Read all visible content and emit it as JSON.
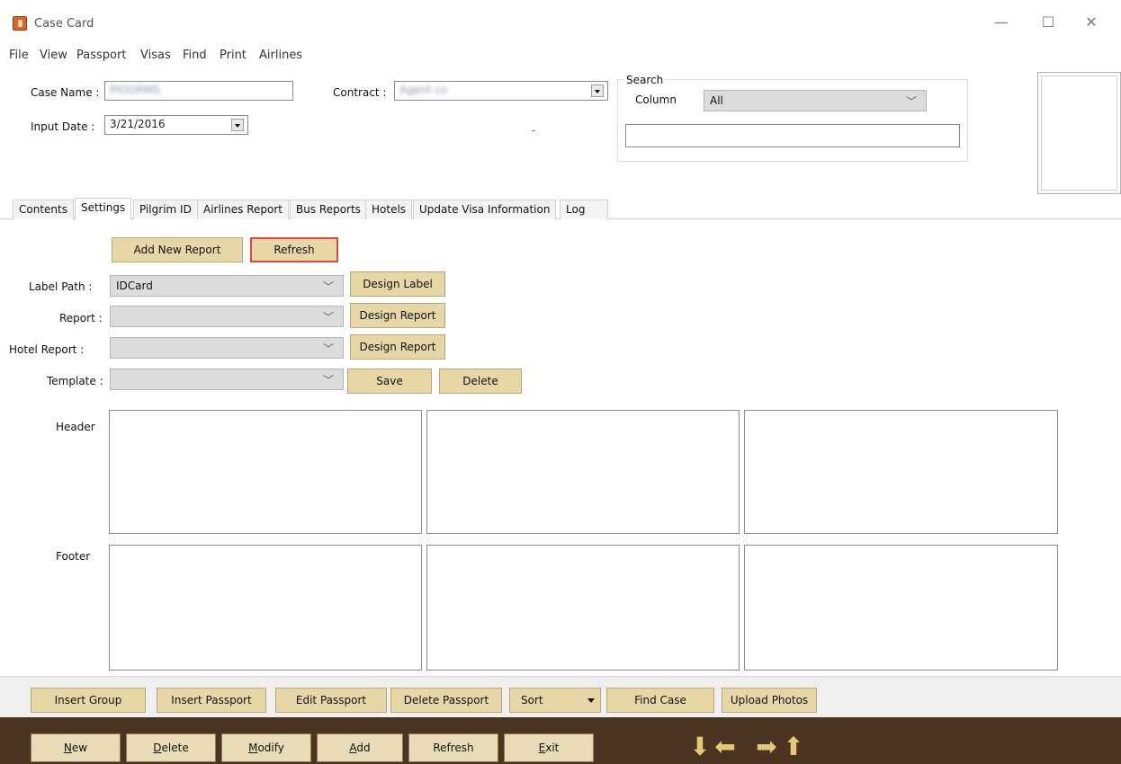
{
  "window": {
    "title": "Case Card"
  },
  "menu": [
    "File",
    "View",
    "Passport",
    "Visas",
    "Find",
    "Print",
    "Airlines"
  ],
  "header": {
    "case_name_label": "Case Name :",
    "case_name_value": "PIOGRMS",
    "contract_label": "Contract :",
    "contract_value": "Agent co",
    "input_date_label": "Input Date :",
    "input_date_value": "3/21/2016",
    "dash": "-"
  },
  "search": {
    "group_label": "Search",
    "column_label": "Column",
    "column_value": "All",
    "query_value": ""
  },
  "tabs": [
    "Contents",
    "Settings",
    "Pilgrim ID",
    "Airlines Report",
    "Bus Reports",
    "Hotels",
    "Update Visa Information",
    "Log"
  ],
  "settings": {
    "add_new_report": "Add New Report",
    "refresh": "Refresh",
    "label_path_label": "Label Path :",
    "label_path_value": "IDCard",
    "design_label": "Design Label",
    "report_label": "Report :",
    "report_value": "",
    "design_report": "Design Report",
    "hotel_report_label": "Hotel Report :",
    "hotel_report_value": "",
    "design_hotel_report": "Design Report",
    "template_label": "Template :",
    "template_value": "",
    "save": "Save",
    "delete": "Delete",
    "header_label": "Header",
    "footer_label": "Footer"
  },
  "toolbar": {
    "insert_group": "Insert Group",
    "insert_passport": "Insert Passport",
    "edit_passport": "Edit Passport",
    "delete_passport": "Delete Passport",
    "sort": "Sort",
    "find_case": "Find Case",
    "upload_photos": "Upload Photos"
  },
  "nav": {
    "new_u": "N",
    "new_rest": "ew",
    "delete_u": "D",
    "delete_rest": "elete",
    "modify_u": "M",
    "modify_rest": "odify",
    "add_u": "A",
    "add_rest": "dd",
    "refresh": "Refresh",
    "exit_u": "E",
    "exit_rest": "xit"
  },
  "colors": {
    "button_tan": "#e7d7a6",
    "status_strip": "#4b3421",
    "highlight": "#e0473f",
    "arrow_gold": "#e6c878"
  },
  "icons": [
    "app-icon",
    "minimize-icon",
    "maximize-icon",
    "close-icon",
    "arrow-down-icon",
    "arrow-left-icon",
    "arrow-right-icon",
    "arrow-up-icon"
  ]
}
